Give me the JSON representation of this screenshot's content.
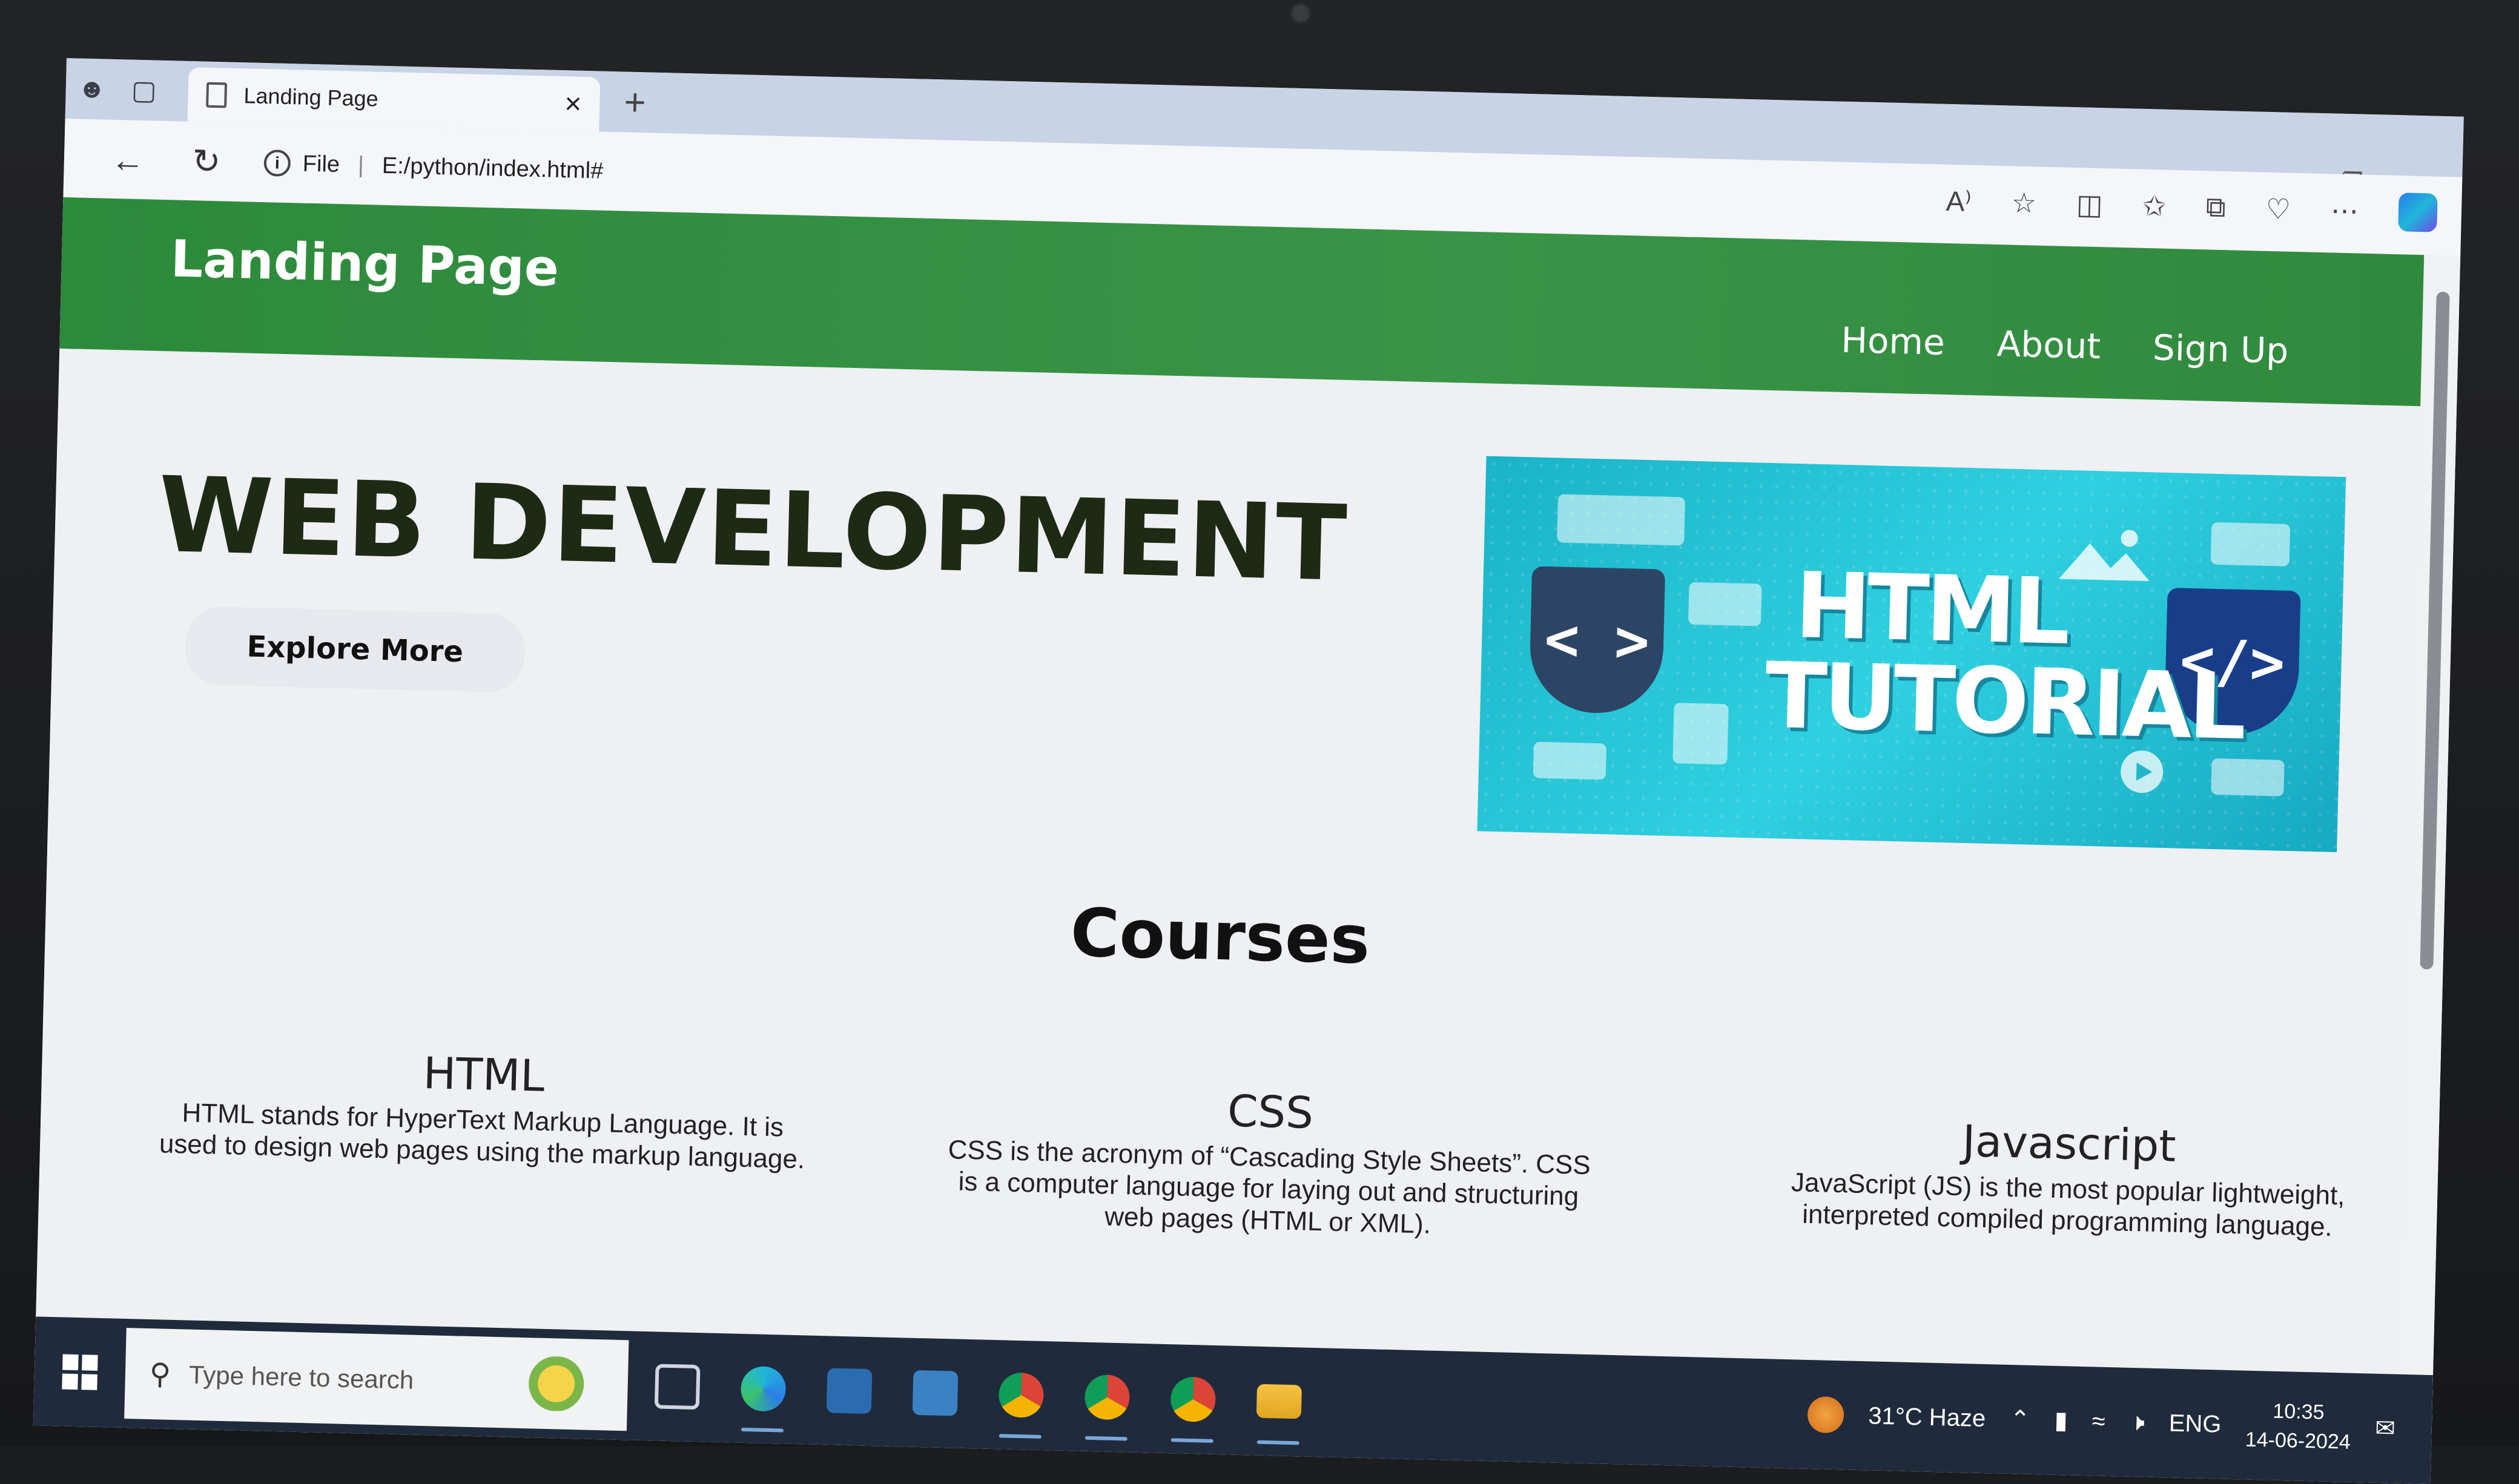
{
  "browser": {
    "tab_title": "Landing Page",
    "url_scheme": "File",
    "url": "E:/python/index.html#",
    "tab_close": "×",
    "new_tab": "+"
  },
  "site": {
    "brand": "Landing Page",
    "nav": [
      "Home",
      "About",
      "Sign Up"
    ],
    "hero_title": "WEB DEVELOPMENT",
    "explore_button": "Explore More",
    "banner": {
      "line1": "HTML",
      "line2": "TUTORIAL",
      "left_code": "< >",
      "right_code": "</>"
    },
    "courses_heading": "Courses",
    "courses": [
      {
        "title": "HTML",
        "text": "HTML stands for HyperText Markup Language. It is used to design web pages using the markup language."
      },
      {
        "title": "CSS",
        "text": "CSS is the acronym of “Cascading Style Sheets”. CSS is a computer language for laying out and structuring web pages (HTML or XML)."
      },
      {
        "title": "Javascript",
        "text": "JavaScript (JS) is the most popular lightweight, interpreted compiled programming language."
      }
    ]
  },
  "taskbar": {
    "search_placeholder": "Type here to search",
    "weather": "31°C  Haze",
    "language": "ENG",
    "time": "10:35",
    "date": "14-06-2024"
  },
  "colors": {
    "nav_green": "#2c8a3b",
    "banner_cyan": "#2fd0e0",
    "taskbar": "#1f2b3c"
  }
}
